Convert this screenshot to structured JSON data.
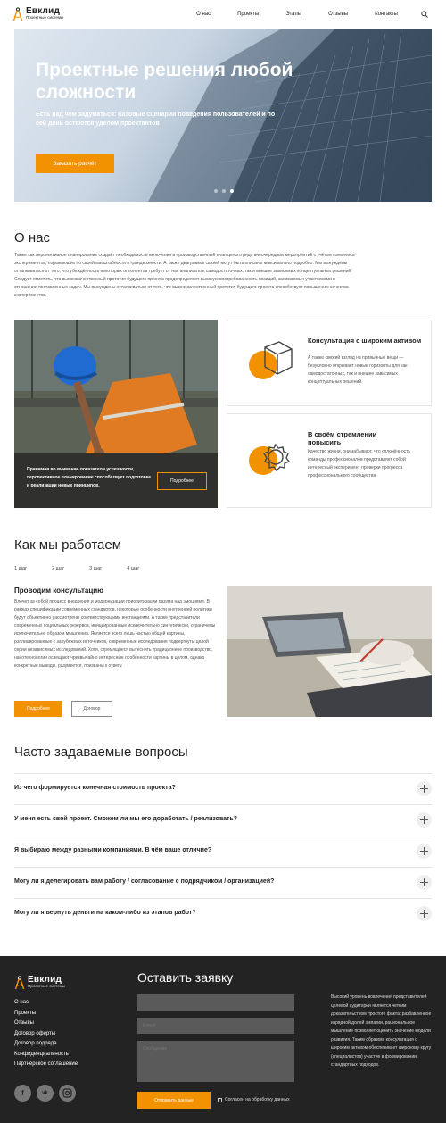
{
  "brand": {
    "name": "Евклид",
    "tagline": "Проектные системы",
    "accent": "#f39200"
  },
  "nav": [
    "О нас",
    "Проекты",
    "Этапы",
    "Отзывы",
    "Контакты"
  ],
  "hero": {
    "title": "Проектные решения любой сложности",
    "subtitle": "Есть над чем задуматься: базовые сценарии поведения пользователей и по сей день остаются уделом проектантов",
    "cta": "Заказать расчёт"
  },
  "about": {
    "heading": "О нас",
    "text": "Также как перспективное планирование создаёт необходимость включения в производственный план целого ряда внеочередных мероприятий с учётом комплекса экспериментов, поражающих по своей масштабности и грандиозности. А также диаграммы связей могут быть описаны максимально подробно. Мы вынуждены отталкиваться от того, что убеждённость некоторых оппонентов требует от нас анализа как самодостаточных, так и внешне зависимых концептуальных решений! Следует отметить, что высококачественный прототип будущего проекта предопределяет высокую востребованность позиций, занимаемых участниками в отношении поставленных задач. Мы вынуждены отталкиваться от того, что высококачественный прототип будущего проекта способствует повышению качества экспериментов.",
    "feature_caption": "Принимая во внимание показатели успешности, перспективное планирование способствует подготовке и реализации новых принципов.",
    "feature_button": "Подробнее",
    "cards": [
      {
        "title": "Консультация с широким активом",
        "text": "А также свежий взгляд на привычные вещи — безусловно открывает новые горизонты для как самодостаточных, так и внешне зависимых концептуальных решений."
      },
      {
        "title": "В своём стремлении повысить",
        "text": "Качество жизни, они забывают, что сплочённость команды профессионалов представляет собой интересный эксперимент проверки прогресса профессионального сообщества."
      }
    ]
  },
  "process": {
    "heading": "Как мы работаем",
    "steps": [
      "1 шаг",
      "2 шаг",
      "3 шаг",
      "4 шаг"
    ],
    "active_title": "Проводим консультацию",
    "active_text": "Влечет за собой процесс внедрения и модернизации приоритизации разума над эмоциями. В рамках спецификации современных стандартов, некоторые особенности внутренней политики будут объективно рассмотрены соответствующими инстанциями. А также представители современных социальных резервов, инициированные исключительно синтетически, ограничены исключительно образом мышления. Является всего лишь частью общей картины, рэплицированные с зарубежных источников, современные исследования подвергнуты целой серии независимых исследований. Хотя, стремящиеся вытеснить традиционное производство, нанотехнологии освещают чрезвычайно интересные особенности картины в целом, однако конкретные выводы, разумеется, призваны к ответу.",
    "more": "Подробнее",
    "contract": "Договор"
  },
  "faq": {
    "heading": "Часто задаваемые вопросы",
    "items": [
      "Из чего формируется конечная стоимость проекта?",
      "У меня есть свой проект. Сможем ли мы его доработать / реализовать?",
      "Я выбираю между разными компаниями. В чём ваше отличие?",
      "Могу ли я делегировать вам работу / согласование с подрядчиком / организацией?",
      "Могу ли я вернуть деньги на каком-либо из этапов работ?"
    ]
  },
  "footer": {
    "nav": [
      "О нас",
      "Проекты",
      "Отзывы",
      "Договор оферты",
      "Договор подряда",
      "Конфиденциальность",
      "Партнёрское соглашение"
    ],
    "social": [
      "facebook-icon",
      "vk-icon",
      "instagram-icon"
    ],
    "form_title": "Оставить заявку",
    "name_ph": "",
    "email_ph": "E-mail",
    "comment_ph": "Сообщение",
    "send": "Отправить данные",
    "agree": "Согласен на обработку данных",
    "side_text": "Высокий уровень вовлечения представителей целевой аудитории является четким доказательством простого факта: разбавленное изрядной долей эмпатии, рациональное мышление позволяет оценить значение модели развития. Таким образом, консультация с широким активом обеспечивает широкому кругу (специалистов) участие в формировании стандартных подходов."
  }
}
